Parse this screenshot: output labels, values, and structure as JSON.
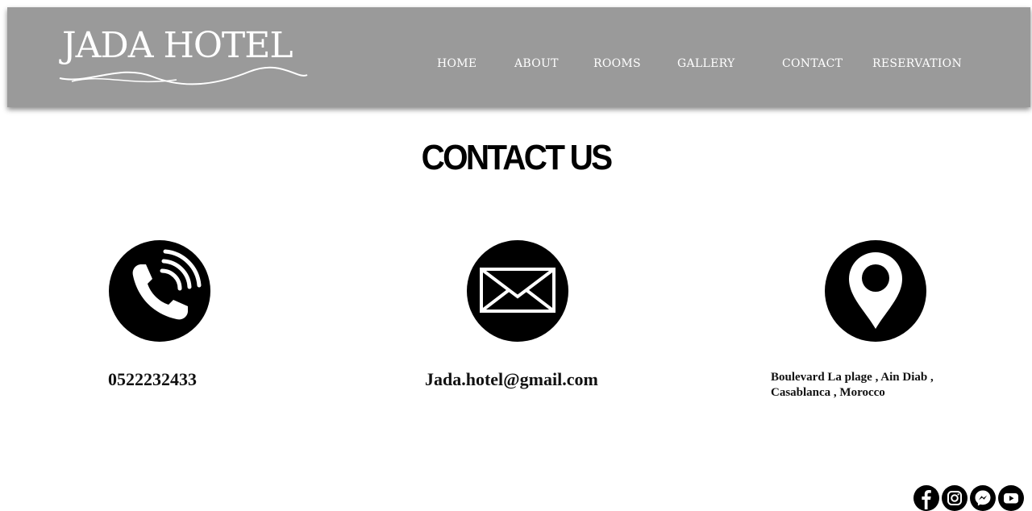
{
  "brand": {
    "logo_text": "JADA HOTEL"
  },
  "nav": {
    "items": [
      {
        "label": "HOME"
      },
      {
        "label": "ABOUT"
      },
      {
        "label": "ROOMS"
      },
      {
        "label": "GALLERY"
      },
      {
        "label": "CONTACT"
      },
      {
        "label": "RESERVATION"
      }
    ]
  },
  "main": {
    "title": "CONTACT US",
    "phone": "0522232433",
    "email": "Jada.hotel@gmail.com",
    "address_line1": "Boulevard La plage , Ain Diab ,",
    "address_line2": "Casablanca , Morocco"
  },
  "icons": {
    "contact": [
      "phone-icon",
      "envelope-icon",
      "location-pin-icon"
    ],
    "social": [
      "facebook-icon",
      "instagram-icon",
      "messenger-icon",
      "youtube-icon"
    ]
  },
  "colors": {
    "header_bg": "#9a9a9a",
    "text": "#000000",
    "header_text": "#ffffff"
  }
}
